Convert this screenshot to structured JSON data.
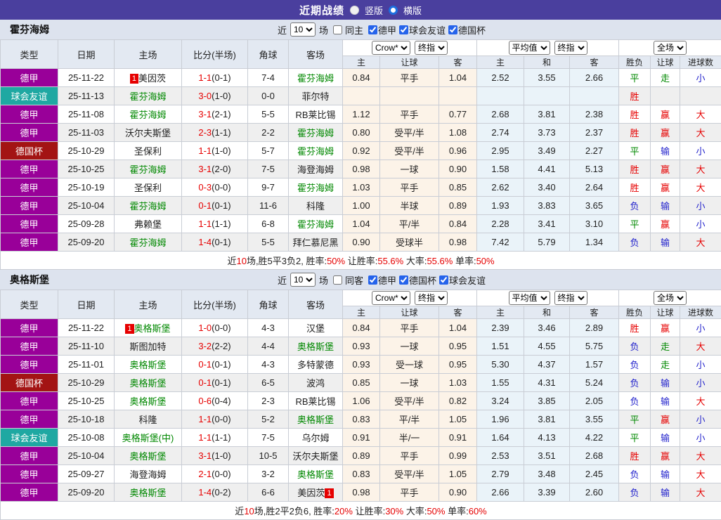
{
  "colors": {
    "topbar": "#4a3f9e",
    "type_league": "#990099",
    "type_friendly": "#1fa8a2",
    "type_cup": "#a31414",
    "team_green": "#008800",
    "score_red": "#e60000",
    "result_red": "#e60000",
    "result_green": "#008800",
    "result_blue": "#2222cc"
  },
  "topbar": {
    "title": "近期战绩",
    "radio_vertical": "竖版",
    "radio_horizontal": "横版"
  },
  "table_header": {
    "type": "类型",
    "date": "日期",
    "home": "主场",
    "score": "比分(半场)",
    "corner": "角球",
    "away": "客场",
    "odds_sub": [
      "主",
      "让球",
      "客"
    ],
    "avg_sub": [
      "主",
      "和",
      "客"
    ],
    "result_sub": [
      "胜负",
      "让球",
      "进球数"
    ]
  },
  "type_colors": {
    "德甲": "#990099",
    "球会友谊": "#1fa8a2",
    "德国杯": "#a31414"
  },
  "sections": [
    {
      "team": "霍芬海姆",
      "filter": {
        "near": "近",
        "count": "10",
        "games": "场",
        "same_label": "同主",
        "same_checked": false,
        "leagues": [
          {
            "label": "德甲",
            "checked": true
          },
          {
            "label": "球会友谊",
            "checked": true
          },
          {
            "label": "德国杯",
            "checked": true
          }
        ]
      },
      "selects": {
        "odds_src": "Crow*",
        "odds_stage": "终指",
        "avg_src": "平均值",
        "avg_stage": "终指",
        "scope": "全场"
      },
      "rows": [
        {
          "type": "德甲",
          "date": "25-11-22",
          "home": {
            "name": "美因茨",
            "green": false,
            "badge": "1",
            "badge_pos": "before"
          },
          "score": "1-1",
          "half": "(0-1)",
          "corner": "7-4",
          "away": {
            "name": "霍芬海姆",
            "green": true
          },
          "odds": [
            "0.84",
            "平手",
            "1.04"
          ],
          "avg": [
            "2.52",
            "3.55",
            "2.66"
          ],
          "results": [
            [
              "平",
              "green"
            ],
            [
              "走",
              "green"
            ],
            [
              "小",
              "blue"
            ]
          ]
        },
        {
          "type": "球会友谊",
          "date": "25-11-13",
          "home": {
            "name": "霍芬海姆",
            "green": true
          },
          "score": "3-0",
          "half": "(1-0)",
          "corner": "0-0",
          "away": {
            "name": "菲尔特",
            "green": false
          },
          "odds": [
            "",
            "",
            ""
          ],
          "avg": [
            "",
            "",
            ""
          ],
          "results": [
            [
              "胜",
              "red"
            ],
            [
              "",
              ""
            ],
            [
              "",
              ""
            ]
          ]
        },
        {
          "type": "德甲",
          "date": "25-11-08",
          "home": {
            "name": "霍芬海姆",
            "green": true
          },
          "score": "3-1",
          "half": "(2-1)",
          "corner": "5-5",
          "away": {
            "name": "RB莱比锡",
            "green": false
          },
          "odds": [
            "1.12",
            "平手",
            "0.77"
          ],
          "avg": [
            "2.68",
            "3.81",
            "2.38"
          ],
          "results": [
            [
              "胜",
              "red"
            ],
            [
              "赢",
              "red"
            ],
            [
              "大",
              "red"
            ]
          ]
        },
        {
          "type": "德甲",
          "date": "25-11-03",
          "home": {
            "name": "沃尔夫斯堡",
            "green": false
          },
          "score": "2-3",
          "half": "(1-1)",
          "corner": "2-2",
          "away": {
            "name": "霍芬海姆",
            "green": true
          },
          "odds": [
            "0.80",
            "受平/半",
            "1.08"
          ],
          "avg": [
            "2.74",
            "3.73",
            "2.37"
          ],
          "results": [
            [
              "胜",
              "red"
            ],
            [
              "赢",
              "red"
            ],
            [
              "大",
              "red"
            ]
          ]
        },
        {
          "type": "德国杯",
          "date": "25-10-29",
          "home": {
            "name": "圣保利",
            "green": false
          },
          "score": "1-1",
          "half": "(1-0)",
          "corner": "5-7",
          "away": {
            "name": "霍芬海姆",
            "green": true
          },
          "odds": [
            "0.92",
            "受平/半",
            "0.96"
          ],
          "avg": [
            "2.95",
            "3.49",
            "2.27"
          ],
          "results": [
            [
              "平",
              "green"
            ],
            [
              "输",
              "blue"
            ],
            [
              "小",
              "blue"
            ]
          ]
        },
        {
          "type": "德甲",
          "date": "25-10-25",
          "home": {
            "name": "霍芬海姆",
            "green": true
          },
          "score": "3-1",
          "half": "(2-0)",
          "corner": "7-5",
          "away": {
            "name": "海登海姆",
            "green": false
          },
          "odds": [
            "0.98",
            "一球",
            "0.90"
          ],
          "avg": [
            "1.58",
            "4.41",
            "5.13"
          ],
          "results": [
            [
              "胜",
              "red"
            ],
            [
              "赢",
              "red"
            ],
            [
              "大",
              "red"
            ]
          ]
        },
        {
          "type": "德甲",
          "date": "25-10-19",
          "home": {
            "name": "圣保利",
            "green": false
          },
          "score": "0-3",
          "half": "(0-0)",
          "corner": "9-7",
          "away": {
            "name": "霍芬海姆",
            "green": true
          },
          "odds": [
            "1.03",
            "平手",
            "0.85"
          ],
          "avg": [
            "2.62",
            "3.40",
            "2.64"
          ],
          "results": [
            [
              "胜",
              "red"
            ],
            [
              "赢",
              "red"
            ],
            [
              "大",
              "red"
            ]
          ]
        },
        {
          "type": "德甲",
          "date": "25-10-04",
          "home": {
            "name": "霍芬海姆",
            "green": true
          },
          "score": "0-1",
          "half": "(0-1)",
          "corner": "11-6",
          "away": {
            "name": "科隆",
            "green": false
          },
          "odds": [
            "1.00",
            "半球",
            "0.89"
          ],
          "avg": [
            "1.93",
            "3.83",
            "3.65"
          ],
          "results": [
            [
              "负",
              "blue"
            ],
            [
              "输",
              "blue"
            ],
            [
              "小",
              "blue"
            ]
          ]
        },
        {
          "type": "德甲",
          "date": "25-09-28",
          "home": {
            "name": "弗赖堡",
            "green": false
          },
          "score": "1-1",
          "half": "(1-1)",
          "corner": "6-8",
          "away": {
            "name": "霍芬海姆",
            "green": true
          },
          "odds": [
            "1.04",
            "平/半",
            "0.84"
          ],
          "avg": [
            "2.28",
            "3.41",
            "3.10"
          ],
          "results": [
            [
              "平",
              "green"
            ],
            [
              "赢",
              "red"
            ],
            [
              "小",
              "blue"
            ]
          ]
        },
        {
          "type": "德甲",
          "date": "25-09-20",
          "home": {
            "name": "霍芬海姆",
            "green": true
          },
          "score": "1-4",
          "half": "(0-1)",
          "corner": "5-5",
          "away": {
            "name": "拜仁慕尼黑",
            "green": false
          },
          "odds": [
            "0.90",
            "受球半",
            "0.98"
          ],
          "avg": [
            "7.42",
            "5.79",
            "1.34"
          ],
          "results": [
            [
              "负",
              "blue"
            ],
            [
              "输",
              "blue"
            ],
            [
              "大",
              "red"
            ]
          ]
        }
      ],
      "summary": [
        {
          "t": "近",
          "red": false
        },
        {
          "t": "10",
          "red": true
        },
        {
          "t": "场,胜5平3负2, 胜率:",
          "red": false
        },
        {
          "t": "50%",
          "red": true
        },
        {
          "t": " 让胜率:",
          "red": false
        },
        {
          "t": "55.6%",
          "red": true
        },
        {
          "t": " 大率:",
          "red": false
        },
        {
          "t": "55.6%",
          "red": true
        },
        {
          "t": " 单率:",
          "red": false
        },
        {
          "t": "50%",
          "red": true
        }
      ]
    },
    {
      "team": "奥格斯堡",
      "filter": {
        "near": "近",
        "count": "10",
        "games": "场",
        "same_label": "同客",
        "same_checked": false,
        "leagues": [
          {
            "label": "德甲",
            "checked": true
          },
          {
            "label": "德国杯",
            "checked": true
          },
          {
            "label": "球会友谊",
            "checked": true
          }
        ]
      },
      "selects": {
        "odds_src": "Crow*",
        "odds_stage": "终指",
        "avg_src": "平均值",
        "avg_stage": "终指",
        "scope": "全场"
      },
      "rows": [
        {
          "type": "德甲",
          "date": "25-11-22",
          "home": {
            "name": "奥格斯堡",
            "green": true,
            "badge": "1",
            "badge_pos": "before"
          },
          "score": "1-0",
          "half": "(0-0)",
          "corner": "4-3",
          "away": {
            "name": "汉堡",
            "green": false
          },
          "odds": [
            "0.84",
            "平手",
            "1.04"
          ],
          "avg": [
            "2.39",
            "3.46",
            "2.89"
          ],
          "results": [
            [
              "胜",
              "red"
            ],
            [
              "赢",
              "red"
            ],
            [
              "小",
              "blue"
            ]
          ]
        },
        {
          "type": "德甲",
          "date": "25-11-10",
          "home": {
            "name": "斯图加特",
            "green": false
          },
          "score": "3-2",
          "half": "(2-2)",
          "corner": "4-4",
          "away": {
            "name": "奥格斯堡",
            "green": true
          },
          "odds": [
            "0.93",
            "一球",
            "0.95"
          ],
          "avg": [
            "1.51",
            "4.55",
            "5.75"
          ],
          "results": [
            [
              "负",
              "blue"
            ],
            [
              "走",
              "green"
            ],
            [
              "大",
              "red"
            ]
          ]
        },
        {
          "type": "德甲",
          "date": "25-11-01",
          "home": {
            "name": "奥格斯堡",
            "green": true
          },
          "score": "0-1",
          "half": "(0-1)",
          "corner": "4-3",
          "away": {
            "name": "多特蒙德",
            "green": false
          },
          "odds": [
            "0.93",
            "受一球",
            "0.95"
          ],
          "avg": [
            "5.30",
            "4.37",
            "1.57"
          ],
          "results": [
            [
              "负",
              "blue"
            ],
            [
              "走",
              "green"
            ],
            [
              "小",
              "blue"
            ]
          ]
        },
        {
          "type": "德国杯",
          "date": "25-10-29",
          "home": {
            "name": "奥格斯堡",
            "green": true
          },
          "score": "0-1",
          "half": "(0-1)",
          "corner": "6-5",
          "away": {
            "name": "波鸿",
            "green": false
          },
          "odds": [
            "0.85",
            "一球",
            "1.03"
          ],
          "avg": [
            "1.55",
            "4.31",
            "5.24"
          ],
          "results": [
            [
              "负",
              "blue"
            ],
            [
              "输",
              "blue"
            ],
            [
              "小",
              "blue"
            ]
          ]
        },
        {
          "type": "德甲",
          "date": "25-10-25",
          "home": {
            "name": "奥格斯堡",
            "green": true
          },
          "score": "0-6",
          "half": "(0-4)",
          "corner": "2-3",
          "away": {
            "name": "RB莱比锡",
            "green": false
          },
          "odds": [
            "1.06",
            "受平/半",
            "0.82"
          ],
          "avg": [
            "3.24",
            "3.85",
            "2.05"
          ],
          "results": [
            [
              "负",
              "blue"
            ],
            [
              "输",
              "blue"
            ],
            [
              "大",
              "red"
            ]
          ]
        },
        {
          "type": "德甲",
          "date": "25-10-18",
          "home": {
            "name": "科隆",
            "green": false
          },
          "score": "1-1",
          "half": "(0-0)",
          "corner": "5-2",
          "away": {
            "name": "奥格斯堡",
            "green": true
          },
          "odds": [
            "0.83",
            "平/半",
            "1.05"
          ],
          "avg": [
            "1.96",
            "3.81",
            "3.55"
          ],
          "results": [
            [
              "平",
              "green"
            ],
            [
              "赢",
              "red"
            ],
            [
              "小",
              "blue"
            ]
          ]
        },
        {
          "type": "球会友谊",
          "date": "25-10-08",
          "home": {
            "name": "奥格斯堡(中)",
            "green": true
          },
          "score": "1-1",
          "half": "(1-1)",
          "corner": "7-5",
          "away": {
            "name": "乌尔姆",
            "green": false
          },
          "odds": [
            "0.91",
            "半/一",
            "0.91"
          ],
          "avg": [
            "1.64",
            "4.13",
            "4.22"
          ],
          "results": [
            [
              "平",
              "green"
            ],
            [
              "输",
              "blue"
            ],
            [
              "小",
              "blue"
            ]
          ]
        },
        {
          "type": "德甲",
          "date": "25-10-04",
          "home": {
            "name": "奥格斯堡",
            "green": true
          },
          "score": "3-1",
          "half": "(1-0)",
          "corner": "10-5",
          "away": {
            "name": "沃尔夫斯堡",
            "green": false
          },
          "odds": [
            "0.89",
            "平手",
            "0.99"
          ],
          "avg": [
            "2.53",
            "3.51",
            "2.68"
          ],
          "results": [
            [
              "胜",
              "red"
            ],
            [
              "赢",
              "red"
            ],
            [
              "大",
              "red"
            ]
          ]
        },
        {
          "type": "德甲",
          "date": "25-09-27",
          "home": {
            "name": "海登海姆",
            "green": false
          },
          "score": "2-1",
          "half": "(0-0)",
          "corner": "3-2",
          "away": {
            "name": "奥格斯堡",
            "green": true
          },
          "odds": [
            "0.83",
            "受平/半",
            "1.05"
          ],
          "avg": [
            "2.79",
            "3.48",
            "2.45"
          ],
          "results": [
            [
              "负",
              "blue"
            ],
            [
              "输",
              "blue"
            ],
            [
              "大",
              "red"
            ]
          ]
        },
        {
          "type": "德甲",
          "date": "25-09-20",
          "home": {
            "name": "奥格斯堡",
            "green": true
          },
          "score": "1-4",
          "half": "(0-2)",
          "corner": "6-6",
          "away": {
            "name": "美因茨",
            "green": false,
            "badge": "1",
            "badge_pos": "after"
          },
          "odds": [
            "0.98",
            "平手",
            "0.90"
          ],
          "avg": [
            "2.66",
            "3.39",
            "2.60"
          ],
          "results": [
            [
              "负",
              "blue"
            ],
            [
              "输",
              "blue"
            ],
            [
              "大",
              "red"
            ]
          ]
        }
      ],
      "summary": [
        {
          "t": "近",
          "red": false
        },
        {
          "t": "10",
          "red": true
        },
        {
          "t": "场,胜2平2负6, 胜率:",
          "red": false
        },
        {
          "t": "20%",
          "red": true
        },
        {
          "t": " 让胜率:",
          "red": false
        },
        {
          "t": "30%",
          "red": true
        },
        {
          "t": " 大率:",
          "red": false
        },
        {
          "t": "50%",
          "red": true
        },
        {
          "t": " 单率:",
          "red": false
        },
        {
          "t": "60%",
          "red": true
        }
      ]
    }
  ]
}
